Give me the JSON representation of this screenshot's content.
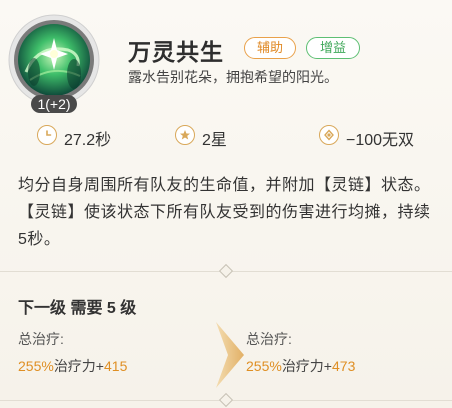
{
  "skill": {
    "level_badge": "1(+2)",
    "name": "万灵共生",
    "tags": [
      "辅助",
      "增益"
    ],
    "subtitle": "露水告别花朵，拥抱希望的阳光。"
  },
  "stats": [
    {
      "icon": "clock-icon",
      "value": "27.2秒"
    },
    {
      "icon": "star-icon",
      "value": "2星"
    },
    {
      "icon": "wuxiang-icon",
      "value": "−100无双"
    }
  ],
  "description": "均分自身周围所有队友的生命值，并附加【灵链】状态。【灵链】使该状态下所有队友受到的伤害进行均摊，持续5秒。",
  "upgrade": {
    "requirement": "下一级 需要 5 级",
    "current": {
      "label": "总治疗:",
      "pct": "255%",
      "mid": "治疗力+",
      "flat": "415"
    },
    "next": {
      "label": "总治疗:",
      "pct": "255%",
      "mid": "治疗力+",
      "flat": "473"
    }
  },
  "colors": {
    "accent_orange": "#e08a26",
    "accent_green": "#3fa859",
    "icon_gold": "#d9a85a"
  }
}
